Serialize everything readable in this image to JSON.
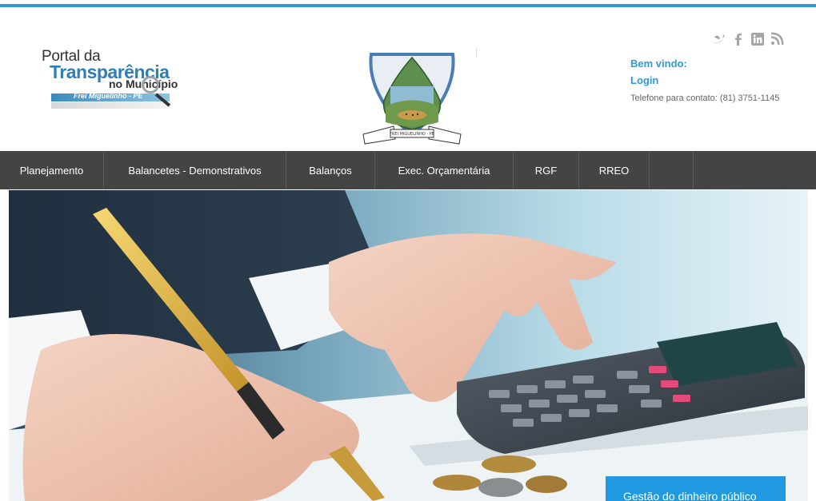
{
  "header": {
    "logo": {
      "line1": "Portal da",
      "line2": "Transparência",
      "line3": "no Município",
      "subtitle": "Frei Miguelinho - PE"
    },
    "crest": {
      "ribbon_text": "FREI MIGUELINHO - PE",
      "icon": "municipal-coat-of-arms"
    },
    "social": [
      {
        "name": "twitter-icon"
      },
      {
        "name": "facebook-icon"
      },
      {
        "name": "linkedin-icon"
      },
      {
        "name": "rss-icon"
      }
    ],
    "welcome": "Bem vindo:",
    "login": "Login",
    "phone": "Telefone para contato: (81) 3751-1145"
  },
  "nav": {
    "items": [
      {
        "label": "Planejamento"
      },
      {
        "label": "Balancetes - Demonstrativos"
      },
      {
        "label": "Balanços"
      },
      {
        "label": "Exec. Orçamentária"
      },
      {
        "label": "RGF"
      },
      {
        "label": "RREO"
      },
      {
        "label": ""
      }
    ]
  },
  "hero": {
    "caption": "Gestão do dinheiro público"
  },
  "colors": {
    "accent": "#2f9ad3",
    "nav_bg": "#444444",
    "caption_bg": "#1f9ae0"
  }
}
